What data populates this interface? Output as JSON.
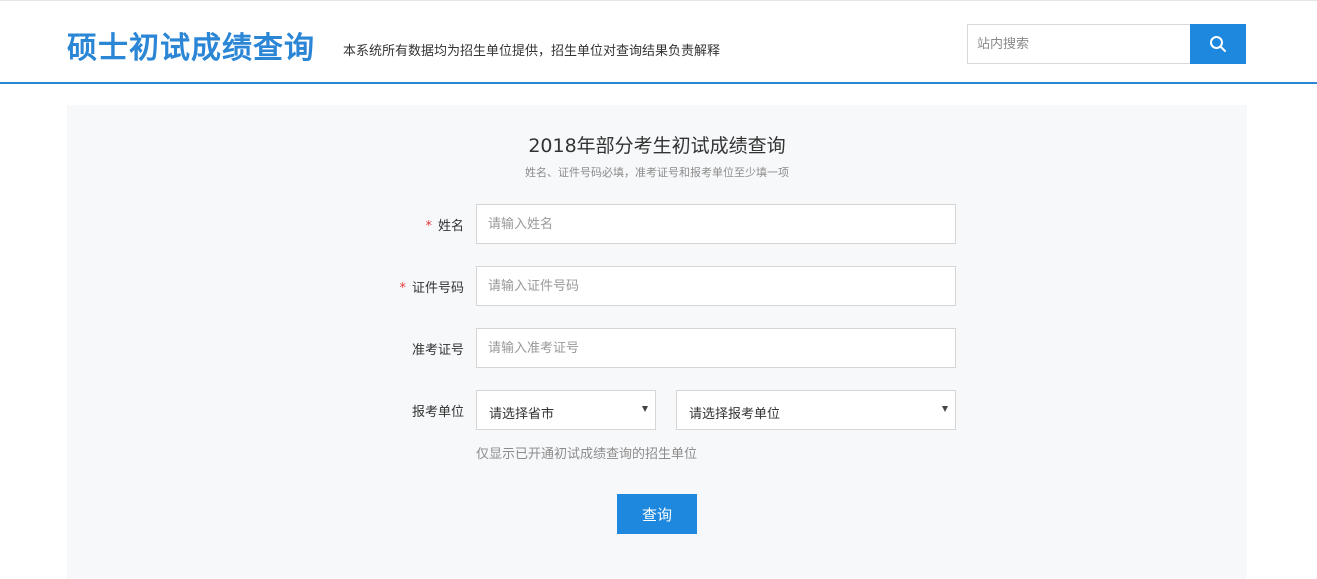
{
  "header": {
    "site_title": "硕士初试成绩查询",
    "disclaimer": "本系统所有数据均为招生单位提供，招生单位对查询结果负责解释",
    "search": {
      "placeholder": "站内搜索",
      "value": ""
    },
    "search_icon": "search-icon"
  },
  "form": {
    "title": "2018年部分考生初试成绩查询",
    "subtitle": "姓名、证件号码必填，准考证号和报考单位至少填一项",
    "fields": {
      "name": {
        "label": "姓名",
        "required_mark": "*",
        "placeholder": "请输入姓名",
        "value": ""
      },
      "id_number": {
        "label": "证件号码",
        "required_mark": "*",
        "placeholder": "请输入证件号码",
        "value": ""
      },
      "exam_number": {
        "label": "准考证号",
        "placeholder": "请输入准考证号",
        "value": ""
      },
      "unit": {
        "label": "报考单位",
        "province_select": "请选择省市",
        "unit_select": "请选择报考单位",
        "hint": "仅显示已开通初试成绩查询的招生单位"
      }
    },
    "submit_label": "查询"
  },
  "colors": {
    "brand": "#2b86d6",
    "button": "#1d88de",
    "required": "#e4393c",
    "panel_bg": "#f7f8fa"
  }
}
